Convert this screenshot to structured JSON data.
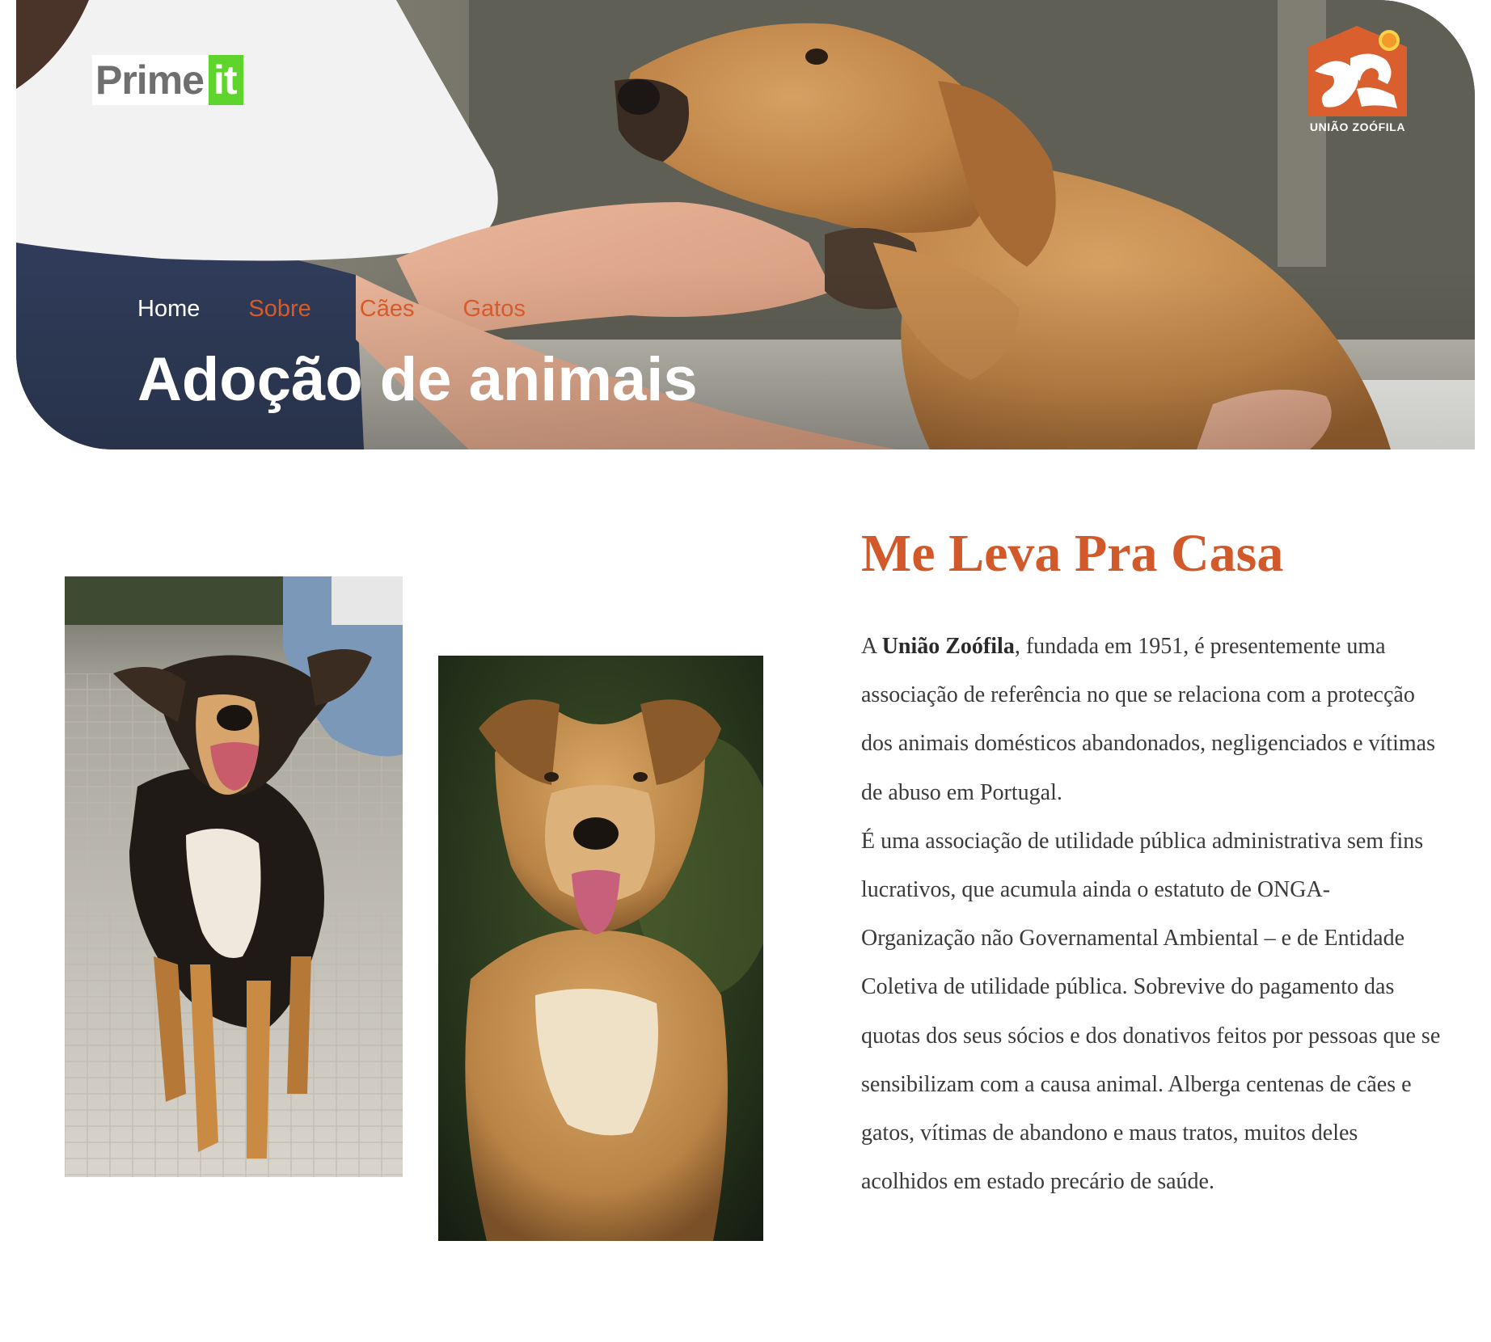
{
  "brand": {
    "logo_part_a": "Prime",
    "logo_part_b": "it"
  },
  "organization": {
    "logo_name": "UNIÃO ZOÓFILA"
  },
  "nav": {
    "items": [
      {
        "label": "Home",
        "active": true
      },
      {
        "label": "Sobre",
        "active": false
      },
      {
        "label": "Cães",
        "active": false
      },
      {
        "label": "Gatos",
        "active": false
      }
    ]
  },
  "hero": {
    "title": "Adoção de animais"
  },
  "about": {
    "title": "Me Leva Pra Casa",
    "intro_prefix": "A ",
    "org_name": "União Zoófila",
    "intro_rest": ", fundada em 1951, é presentemente uma associação de referência no que se relaciona com a protecção dos animais domésticos abandonados, negligenciados e vítimas de abuso em Portugal.",
    "paragraph_2": "É uma associação de utilidade pública administrativa sem fins lucrativos, que acumula ainda o estatuto de ONGA- Organização não Governamental Ambiental – e de Entidade Coletiva de utilidade pública. Sobrevive do pagamento das quotas dos seus sócios e dos donativos feitos por pessoas que se sensibilizam com a causa animal. Alberga centenas de cães e gatos, vítimas de abandono e maus tratos, muitos deles acolhidos em estado precário de saúde."
  },
  "colors": {
    "accent": "#d2592a",
    "nav_inactive": "#d75b2a",
    "logo_green": "#5fd42c",
    "text": "#3a3a3a"
  }
}
